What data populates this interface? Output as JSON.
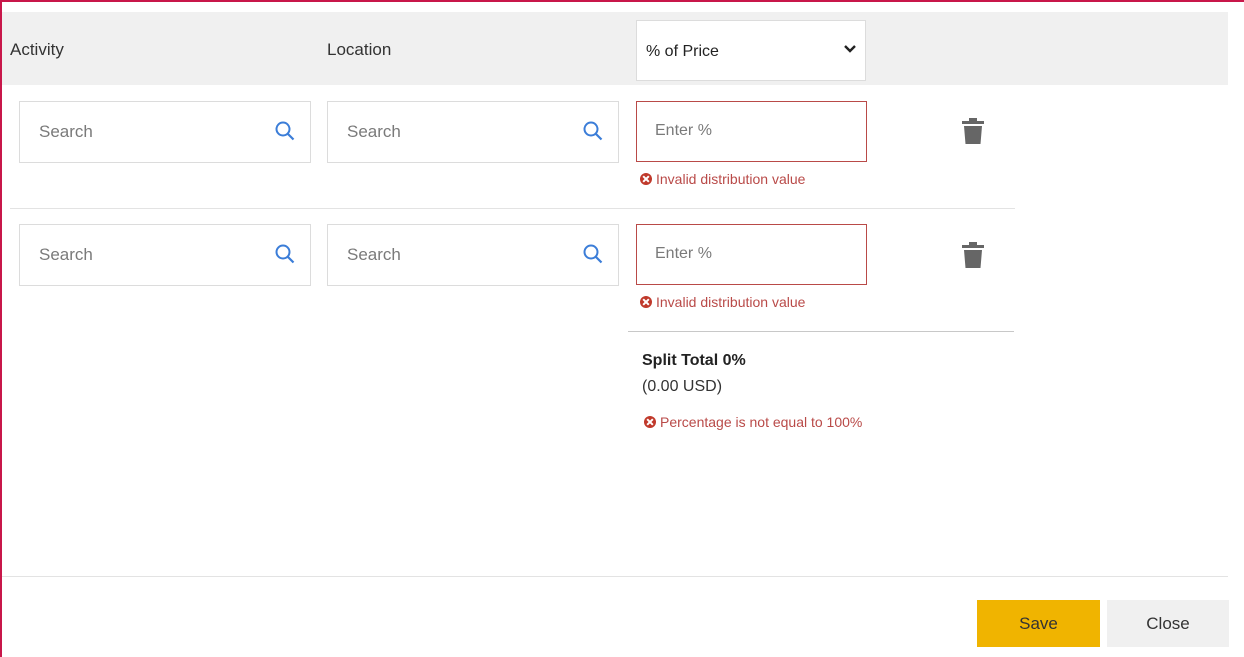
{
  "header": {
    "col_activity": "Activity",
    "col_location": "Location",
    "distribution_type": "% of Price"
  },
  "rows": [
    {
      "activity_placeholder": "Search",
      "location_placeholder": "Search",
      "percent_placeholder": "Enter %",
      "error": "Invalid distribution value"
    },
    {
      "activity_placeholder": "Search",
      "location_placeholder": "Search",
      "percent_placeholder": "Enter %",
      "error": "Invalid distribution value"
    }
  ],
  "summary": {
    "title": "Split Total 0%",
    "amount": "(0.00 USD)",
    "error": "Percentage is not equal to 100%"
  },
  "footer": {
    "save_label": "Save",
    "close_label": "Close"
  },
  "colors": {
    "accent": "#f0b400",
    "error": "#b94a48",
    "search_icon": "#3b7dd8",
    "frame_border": "#c8174a"
  },
  "icons": {
    "search": "search-icon",
    "dropdown": "chevron-down-icon",
    "delete": "trash-icon",
    "error": "error-circle-icon"
  }
}
